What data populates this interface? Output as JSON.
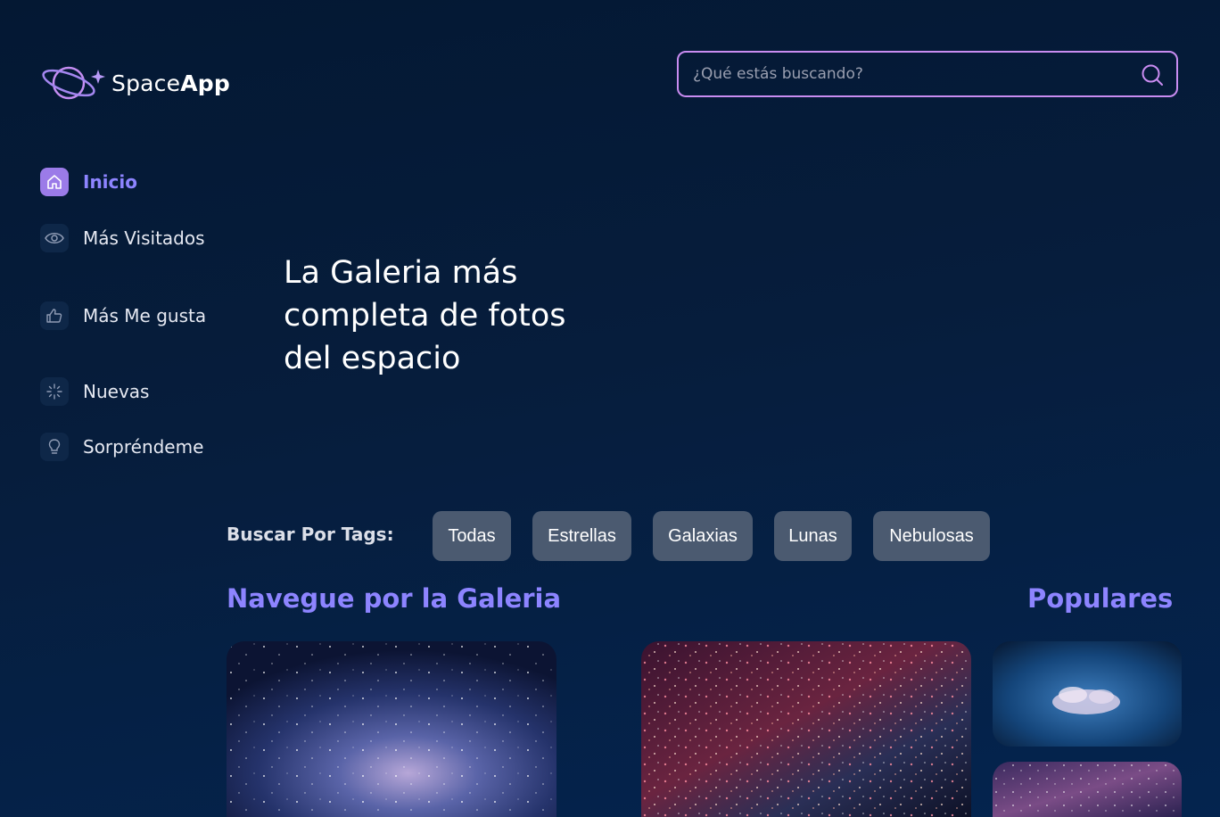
{
  "brand": {
    "name_light": "Space",
    "name_bold": "App"
  },
  "search": {
    "placeholder": "¿Qué estás buscando?",
    "icon": "search-icon"
  },
  "nav": [
    {
      "label": "Inicio",
      "icon": "home-icon",
      "active": true
    },
    {
      "label": "Más Visitados",
      "icon": "eye-icon",
      "active": false
    },
    {
      "label": "Más Me gusta",
      "icon": "thumbs-up-icon",
      "active": false
    },
    {
      "label": "Nuevas",
      "icon": "sparkle-icon",
      "active": false
    },
    {
      "label": "Sorpréndeme",
      "icon": "lightbulb-icon",
      "active": false
    }
  ],
  "hero": {
    "title": "La Galeria más completa de fotos del espacio"
  },
  "tags": {
    "label": "Buscar Por Tags:",
    "items": [
      "Todas",
      "Estrellas",
      "Galaxias",
      "Lunas",
      "Nebulosas"
    ]
  },
  "gallery": {
    "heading": "Navegue por la Galeria"
  },
  "popular": {
    "heading": "Populares"
  },
  "colors": {
    "accent": "#8d84ff",
    "border": "#c98cf1",
    "tag_bg": "#4b5a70",
    "bg": "#041833"
  }
}
